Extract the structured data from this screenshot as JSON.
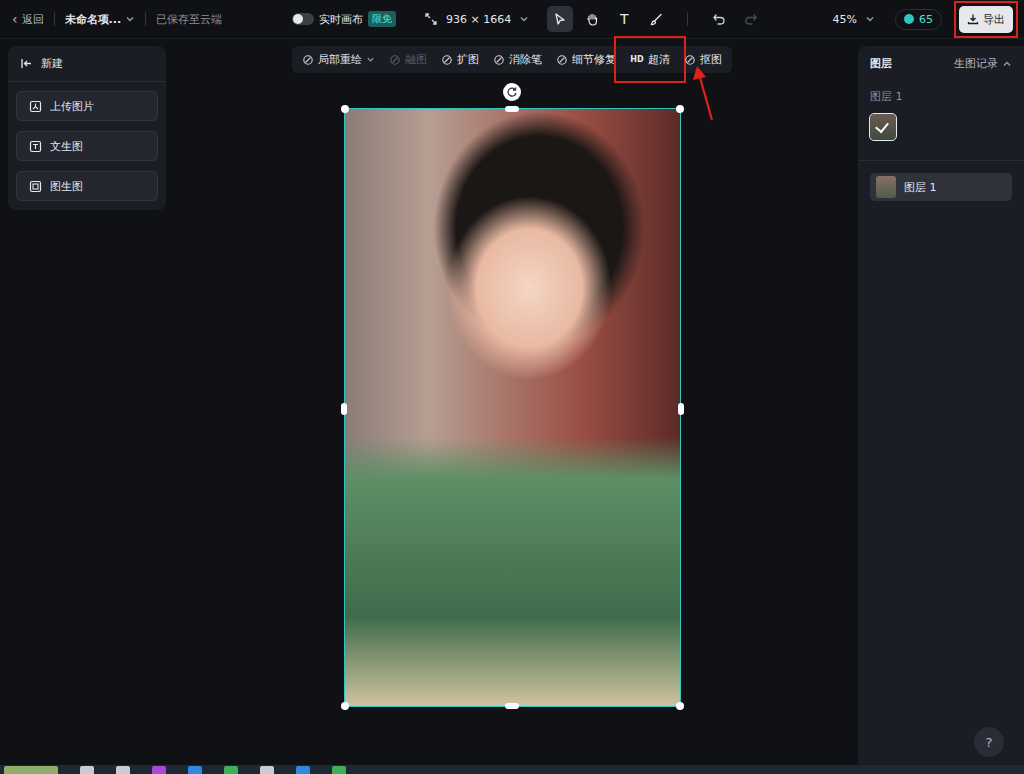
{
  "topbar": {
    "back": {
      "icon": "‹",
      "label": "返回"
    },
    "project": "未命名项...",
    "save_status": "已保存至云端",
    "live_canvas": {
      "label": "实时画布",
      "on": false,
      "badge": "限免"
    },
    "size": "936 × 1664",
    "tools": [
      {
        "name": "select",
        "selected": true
      },
      {
        "name": "hand",
        "selected": false
      },
      {
        "name": "text",
        "glyph": "T",
        "selected": false
      },
      {
        "name": "brush",
        "selected": false
      }
    ],
    "history": [
      {
        "name": "undo",
        "disabled": false
      },
      {
        "name": "redo",
        "disabled": true
      }
    ],
    "zoom": "45%",
    "credits": "65",
    "export": {
      "label": "导出",
      "annotated": true
    }
  },
  "left_panel": {
    "title": "新建",
    "items": [
      "上传图片",
      "文生图",
      "图生图"
    ]
  },
  "toolbar": [
    {
      "label": "局部重绘",
      "prefix": "",
      "dropdown": true,
      "disabled": false,
      "annotated": false
    },
    {
      "label": "融图",
      "prefix": "",
      "dropdown": false,
      "disabled": true,
      "annotated": false
    },
    {
      "label": "扩图",
      "prefix": "",
      "dropdown": false,
      "disabled": false,
      "annotated": false
    },
    {
      "label": "消除笔",
      "prefix": "",
      "dropdown": false,
      "disabled": false,
      "annotated": false
    },
    {
      "label": "细节修复",
      "prefix": "",
      "dropdown": false,
      "disabled": false,
      "annotated": false
    },
    {
      "label": "超清",
      "prefix": "HD",
      "dropdown": false,
      "disabled": false,
      "annotated": true
    },
    {
      "label": "抠图",
      "prefix": "",
      "dropdown": false,
      "disabled": false,
      "annotated": false
    }
  ],
  "canvas": {
    "selected": true
  },
  "right_panel": {
    "title": "图层",
    "history": "生图记录",
    "group_label": "图层 1",
    "layers": [
      {
        "label": "图层 1",
        "selected": true
      }
    ]
  },
  "help": "?"
}
